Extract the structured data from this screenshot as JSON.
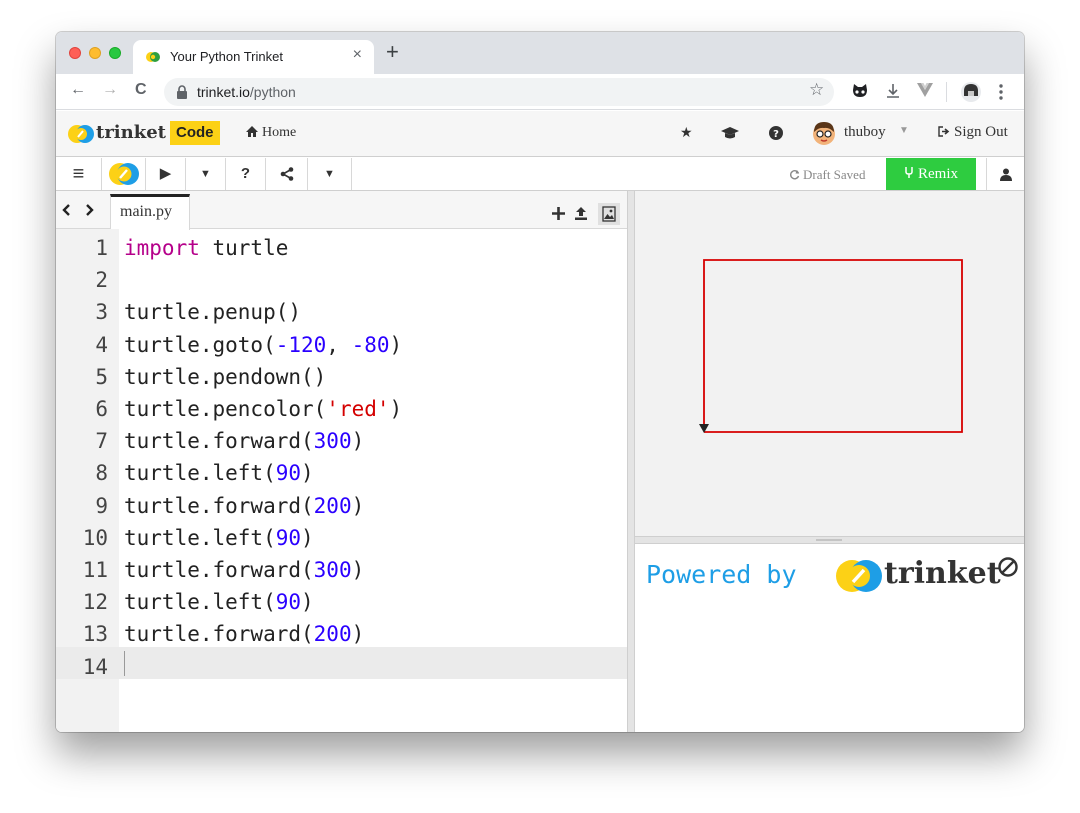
{
  "browser": {
    "tab_title": "Your Python Trinket",
    "tab_close": "×",
    "new_tab": "+",
    "back": "←",
    "forward": "→",
    "reload": "C",
    "url_host": "trinket.io",
    "url_path": "/python",
    "bookmark": "☆"
  },
  "header": {
    "brand": "trinket",
    "badge": "Code",
    "home": "Home",
    "username": "thuboy",
    "signout": "Sign Out"
  },
  "toolbar": {
    "menu": "≡",
    "run": "▶",
    "help": "?",
    "draft_status": "Draft Saved",
    "remix": "Remix"
  },
  "editor": {
    "file_name": "main.py",
    "line_numbers": [
      "1",
      "2",
      "3",
      "4",
      "5",
      "6",
      "7",
      "8",
      "9",
      "10",
      "11",
      "12",
      "13",
      "14"
    ],
    "code_lines": [
      "import turtle",
      "",
      "turtle.penup()",
      "turtle.goto(-120, -80)",
      "turtle.pendown()",
      "turtle.pencolor('red')",
      "turtle.forward(300)",
      "turtle.left(90)",
      "turtle.forward(200)",
      "turtle.left(90)",
      "turtle.forward(300)",
      "turtle.left(90)",
      "turtle.forward(200)",
      ""
    ]
  },
  "output": {
    "powered_by": "Powered by",
    "brand": "trinket",
    "turtle_color": "#d60000"
  },
  "colors": {
    "remix_green": "#2ecc40",
    "badge_yellow": "#fcd116",
    "console_blue": "#1e9ee6"
  }
}
